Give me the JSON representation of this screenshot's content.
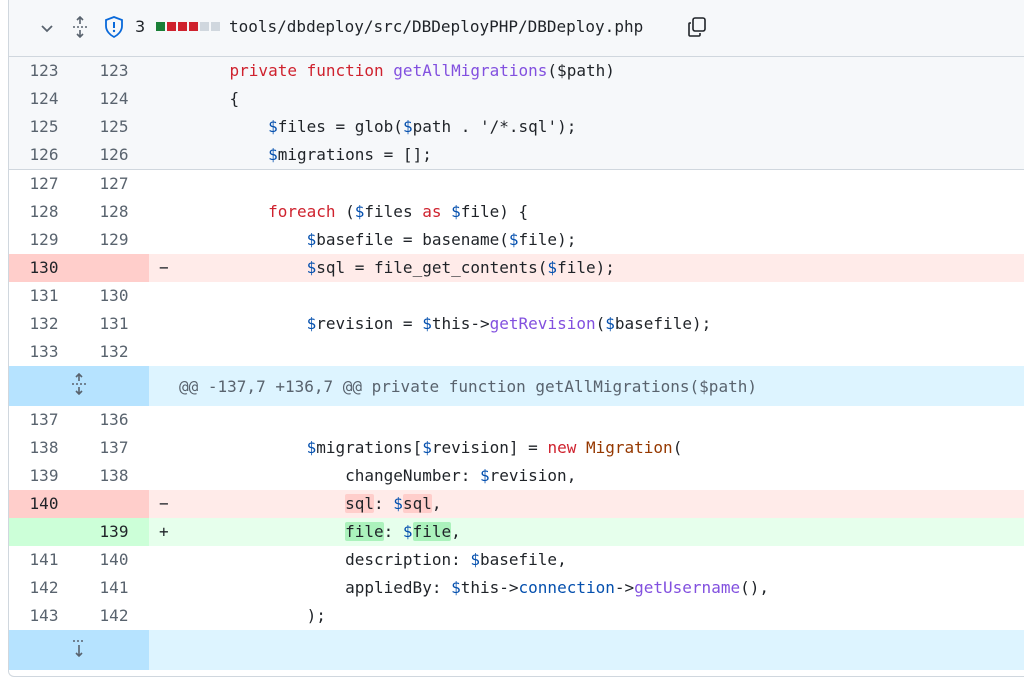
{
  "header": {
    "chevron_icon": "chevron-down-icon",
    "expand_icon": "unfold-icon",
    "shield_icon": "shield-icon",
    "alert_count": "3",
    "diffstat": [
      "#1a7f37",
      "#cf222e",
      "#cf222e",
      "#cf222e",
      "#d0d7de",
      "#d0d7de"
    ],
    "file_path": "tools/dbdeploy/src/DBDeployPHP/DBDeploy.php",
    "copy_icon": "copy-icon"
  },
  "rows": [
    {
      "type": "top",
      "old": "123",
      "new": "123",
      "sign": "",
      "tokens": [
        [
          "",
          "    "
        ],
        [
          "kw",
          "private function "
        ],
        [
          "fn",
          "getAllMigrations"
        ],
        [
          "",
          "($path)"
        ]
      ]
    },
    {
      "type": "top",
      "old": "124",
      "new": "124",
      "sign": "",
      "tokens": [
        [
          "",
          "    {"
        ]
      ]
    },
    {
      "type": "top",
      "old": "125",
      "new": "125",
      "sign": "",
      "tokens": [
        [
          "",
          "        "
        ],
        [
          "var",
          "$"
        ],
        [
          "",
          "files = glob("
        ],
        [
          "var",
          "$"
        ],
        [
          "",
          "path . '/*.sql');"
        ]
      ]
    },
    {
      "type": "top",
      "old": "126",
      "new": "126",
      "sign": "",
      "tokens": [
        [
          "",
          "        "
        ],
        [
          "var",
          "$"
        ],
        [
          "",
          "migrations = [];"
        ]
      ]
    },
    {
      "type": "ctx",
      "old": "127",
      "new": "127",
      "sign": "",
      "tokens": [
        [
          "",
          ""
        ]
      ]
    },
    {
      "type": "ctx",
      "old": "128",
      "new": "128",
      "sign": "",
      "tokens": [
        [
          "",
          "        "
        ],
        [
          "kw",
          "foreach"
        ],
        [
          "",
          " ("
        ],
        [
          "var",
          "$"
        ],
        [
          "",
          "files "
        ],
        [
          "kw",
          "as"
        ],
        [
          "",
          " "
        ],
        [
          "var",
          "$"
        ],
        [
          "",
          "file) {"
        ]
      ]
    },
    {
      "type": "ctx",
      "old": "129",
      "new": "129",
      "sign": "",
      "tokens": [
        [
          "",
          "            "
        ],
        [
          "var",
          "$"
        ],
        [
          "",
          "basefile = basename("
        ],
        [
          "var",
          "$"
        ],
        [
          "",
          "file);"
        ]
      ]
    },
    {
      "type": "del",
      "old": "130",
      "new": "",
      "sign": "−",
      "tokens": [
        [
          "",
          "            "
        ],
        [
          "var",
          "$"
        ],
        [
          "",
          "sql = file_get_contents("
        ],
        [
          "var",
          "$"
        ],
        [
          "",
          "file);"
        ]
      ]
    },
    {
      "type": "ctx",
      "old": "131",
      "new": "130",
      "sign": "",
      "tokens": [
        [
          "",
          ""
        ]
      ]
    },
    {
      "type": "ctx",
      "old": "132",
      "new": "131",
      "sign": "",
      "tokens": [
        [
          "",
          "            "
        ],
        [
          "var",
          "$"
        ],
        [
          "",
          "revision = "
        ],
        [
          "var",
          "$"
        ],
        [
          "",
          "this->"
        ],
        [
          "fn",
          "getRevision"
        ],
        [
          "",
          "("
        ],
        [
          "var",
          "$"
        ],
        [
          "",
          "basefile);"
        ]
      ]
    },
    {
      "type": "ctx",
      "old": "133",
      "new": "132",
      "sign": "",
      "tokens": [
        [
          "",
          ""
        ]
      ]
    },
    {
      "type": "hunk",
      "text": "@@ -137,7 +136,7 @@ private function getAllMigrations($path)"
    },
    {
      "type": "ctx",
      "old": "137",
      "new": "136",
      "sign": "",
      "tokens": [
        [
          "",
          ""
        ]
      ]
    },
    {
      "type": "ctx",
      "old": "138",
      "new": "137",
      "sign": "",
      "tokens": [
        [
          "",
          "            "
        ],
        [
          "var",
          "$"
        ],
        [
          "",
          "migrations["
        ],
        [
          "var",
          "$"
        ],
        [
          "",
          "revision] = "
        ],
        [
          "kw",
          "new"
        ],
        [
          "",
          " "
        ],
        [
          "cls",
          "Migration"
        ],
        [
          "",
          "("
        ]
      ]
    },
    {
      "type": "ctx",
      "old": "139",
      "new": "138",
      "sign": "",
      "tokens": [
        [
          "",
          "                changeNumber: "
        ],
        [
          "var",
          "$"
        ],
        [
          "",
          "revision,"
        ]
      ]
    },
    {
      "type": "del",
      "old": "140",
      "new": "",
      "sign": "−",
      "tokens": [
        [
          "",
          "                "
        ],
        [
          "hl-del",
          "sql"
        ],
        [
          "",
          ": "
        ],
        [
          "var",
          "$"
        ],
        [
          "hl-del",
          "sql"
        ],
        [
          "",
          ","
        ]
      ]
    },
    {
      "type": "add",
      "old": "",
      "new": "139",
      "sign": "+",
      "tokens": [
        [
          "",
          "                "
        ],
        [
          "hl-add",
          "file"
        ],
        [
          "",
          ": "
        ],
        [
          "var",
          "$"
        ],
        [
          "hl-add",
          "file"
        ],
        [
          "",
          ","
        ]
      ]
    },
    {
      "type": "ctx",
      "old": "141",
      "new": "140",
      "sign": "",
      "tokens": [
        [
          "",
          "                description: "
        ],
        [
          "var",
          "$"
        ],
        [
          "",
          "basefile,"
        ]
      ]
    },
    {
      "type": "ctx",
      "old": "142",
      "new": "141",
      "sign": "",
      "tokens": [
        [
          "",
          "                appliedBy: "
        ],
        [
          "var",
          "$"
        ],
        [
          "",
          "this->"
        ],
        [
          "var",
          "connection"
        ],
        [
          "",
          "->"
        ],
        [
          "fn",
          "getUsername"
        ],
        [
          "",
          "(),"
        ]
      ]
    },
    {
      "type": "ctx",
      "old": "143",
      "new": "142",
      "sign": "",
      "tokens": [
        [
          "",
          "            );"
        ]
      ]
    },
    {
      "type": "lastsep"
    }
  ]
}
